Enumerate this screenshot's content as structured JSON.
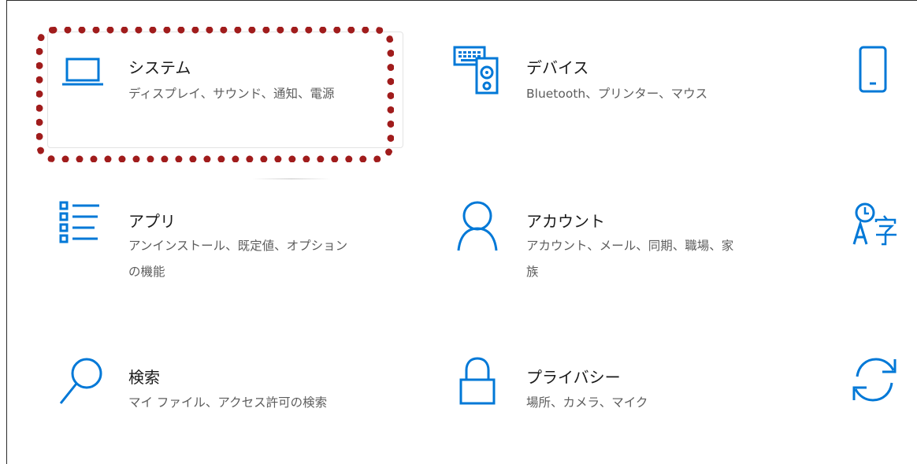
{
  "colors": {
    "accent": "#0078d7",
    "highlight_border": "#a01c1c",
    "title_text": "#1a1a1a",
    "desc_text": "#5d5d5d"
  },
  "tiles": {
    "system": {
      "icon": "laptop-icon",
      "title": "システム",
      "desc": "ディスプレイ、サウンド、通知、電源"
    },
    "devices": {
      "icon": "keyboard-speaker-icon",
      "title": "デバイス",
      "desc": "Bluetooth、プリンター、マウス"
    },
    "phone": {
      "icon": "phone-icon"
    },
    "apps": {
      "icon": "apps-list-icon",
      "title": "アプリ",
      "desc_line1": "アンインストール、既定値、オプション",
      "desc_line2": "の機能"
    },
    "accounts": {
      "icon": "person-icon",
      "title": "アカウント",
      "desc_line1": "アカウント、メール、同期、職場、家",
      "desc_line2": "族"
    },
    "time_language": {
      "icon": "time-language-icon"
    },
    "search": {
      "icon": "search-icon",
      "title": "検索",
      "desc": "マイ ファイル、アクセス許可の検索"
    },
    "privacy": {
      "icon": "lock-icon",
      "title": "プライバシー",
      "desc": "場所、カメラ、マイク"
    },
    "update": {
      "icon": "refresh-icon"
    }
  }
}
